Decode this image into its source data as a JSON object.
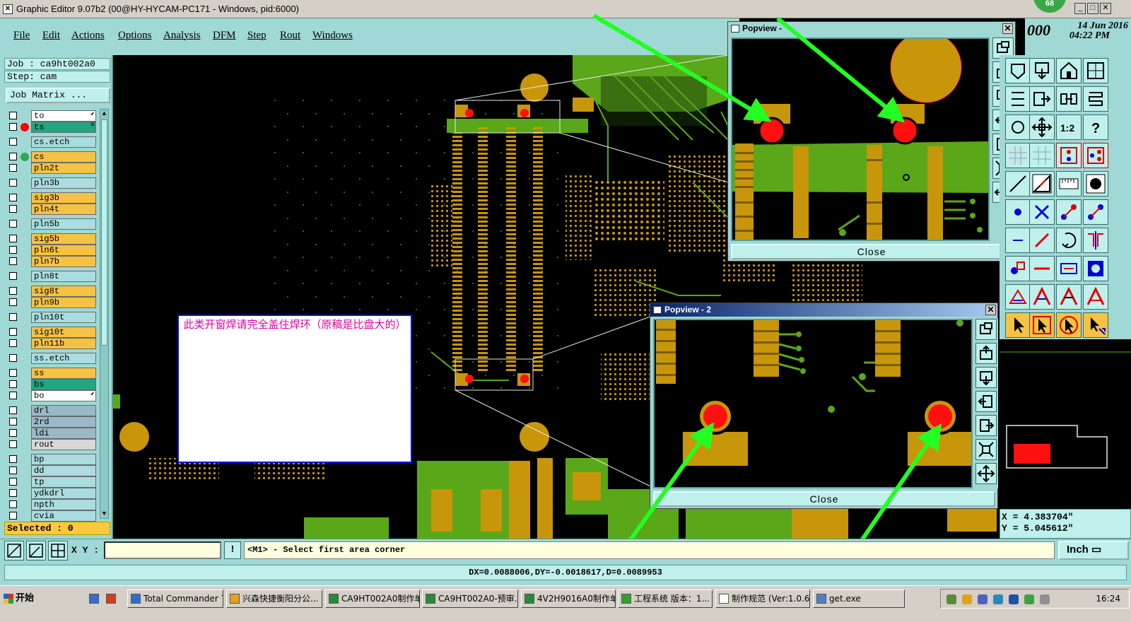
{
  "window": {
    "title": "Graphic Editor 9.07b2 (00@HY-HYCAM-PC171 - Windows, pid:6000)",
    "badge": "68",
    "minimize": "_",
    "maximize": "□",
    "close": "✕"
  },
  "menu": [
    "File",
    "Edit",
    "Actions",
    "Options",
    "Analysis",
    "DFM",
    "Step",
    "Rout",
    "Windows"
  ],
  "datetime": {
    "zero_text": "000",
    "date": "14 Jun 2016",
    "time": "04:22 PM"
  },
  "job": {
    "job_label": "Job : ca9ht002a0",
    "step_label": "Step: cam",
    "matrix_button": "Job Matrix ..."
  },
  "layers": [
    {
      "name": "to",
      "color": "#ffffff",
      "mark": "",
      "flag": "⬋"
    },
    {
      "name": "ts",
      "color": "#1fa87f",
      "mark": "#ff0000",
      "flag": "≡"
    },
    {
      "name": "cs.etch",
      "color": "#a9dde0",
      "mark": ""
    },
    {
      "name": "cs",
      "color": "#f6c243",
      "mark": "#2fa84a"
    },
    {
      "name": "pln2t",
      "color": "#f6c243",
      "mark": ""
    },
    {
      "name": "pln3b",
      "color": "#a9dde0",
      "mark": ""
    },
    {
      "name": "sig3b",
      "color": "#f6c243",
      "mark": ""
    },
    {
      "name": "pln4t",
      "color": "#f6c243",
      "mark": ""
    },
    {
      "name": "pln5b",
      "color": "#a9dde0",
      "mark": ""
    },
    {
      "name": "sig5b",
      "color": "#f6c243",
      "mark": ""
    },
    {
      "name": "pln6t",
      "color": "#f6c243",
      "mark": ""
    },
    {
      "name": "pln7b",
      "color": "#f6c243",
      "mark": ""
    },
    {
      "name": "pln8t",
      "color": "#a9dde0",
      "mark": ""
    },
    {
      "name": "sig8t",
      "color": "#f6c243",
      "mark": ""
    },
    {
      "name": "pln9b",
      "color": "#f6c243",
      "mark": ""
    },
    {
      "name": "pln10t",
      "color": "#a9dde0",
      "mark": ""
    },
    {
      "name": "sig10t",
      "color": "#f6c243",
      "mark": ""
    },
    {
      "name": "pln11b",
      "color": "#f6c243",
      "mark": ""
    },
    {
      "name": "ss.etch",
      "color": "#a9dde0",
      "mark": ""
    },
    {
      "name": "ss",
      "color": "#f6c243",
      "mark": ""
    },
    {
      "name": "bs",
      "color": "#1fa87f",
      "mark": ""
    },
    {
      "name": "bo",
      "color": "#ffffff",
      "mark": "",
      "flag": "⬋"
    },
    {
      "name": "drl",
      "color": "#9ab8c8",
      "mark": ""
    },
    {
      "name": "2rd",
      "color": "#9ab8c8",
      "mark": ""
    },
    {
      "name": "ldi",
      "color": "#9ab8c8",
      "mark": ""
    },
    {
      "name": "rout",
      "color": "#d8d8d8",
      "mark": ""
    },
    {
      "name": "bp",
      "color": "#a9dde0",
      "mark": ""
    },
    {
      "name": "dd",
      "color": "#a9dde0",
      "mark": ""
    },
    {
      "name": "tp",
      "color": "#a9dde0",
      "mark": ""
    },
    {
      "name": "ydkdrl",
      "color": "#a9dde0",
      "mark": ""
    },
    {
      "name": "npth",
      "color": "#a9dde0",
      "mark": ""
    },
    {
      "name": "cvia",
      "color": "#a9dde0",
      "mark": ""
    }
  ],
  "selected": "Selected : 0",
  "annotation": "此类开窗焊请完全盖住焊环（原稿是比盘大的）",
  "popview1": {
    "title": "Popview -",
    "close_label": "Close"
  },
  "popview2": {
    "title": "Popview - 2",
    "close_label": "Close"
  },
  "coords": {
    "x": "X = 4.383704\"",
    "y": "Y = 5.045612\""
  },
  "cmd": {
    "xy_label": "X Y :",
    "xy_value": "",
    "warn": "!",
    "prompt": "<M1> - Select first area corner",
    "unit": "Inch ▭"
  },
  "measure": "DX=0.0088006,DY=-0.0018617,D=0.0089953",
  "taskbar": {
    "start": "开始",
    "items": [
      {
        "label": "Total Commander 7....",
        "icon_color": "#2a6fd0"
      },
      {
        "label": "兴森快捷衡阳分公...",
        "icon_color": "#e8a020"
      },
      {
        "label": "CA9HT002A0制作单...",
        "icon_color": "#2a8a3a"
      },
      {
        "label": "CA9HT002A0-预审...",
        "icon_color": "#2a8a3a"
      },
      {
        "label": "4V2H9016A0制作单...",
        "icon_color": "#2a8a3a"
      },
      {
        "label": "工程系统  版本：1...",
        "icon_color": "#30a030"
      },
      {
        "label": "制作规范 (Ver:1.0.6)",
        "icon_color": "#ffffff"
      },
      {
        "label": "get.exe",
        "icon_color": "#5080c0"
      }
    ],
    "clock": "16:24"
  },
  "colors": {
    "copper": "#c8960a",
    "mask": "#5aa71a",
    "pad": "#ff1010",
    "panel": "#9fd8d4",
    "arrow": "#22ff22"
  }
}
